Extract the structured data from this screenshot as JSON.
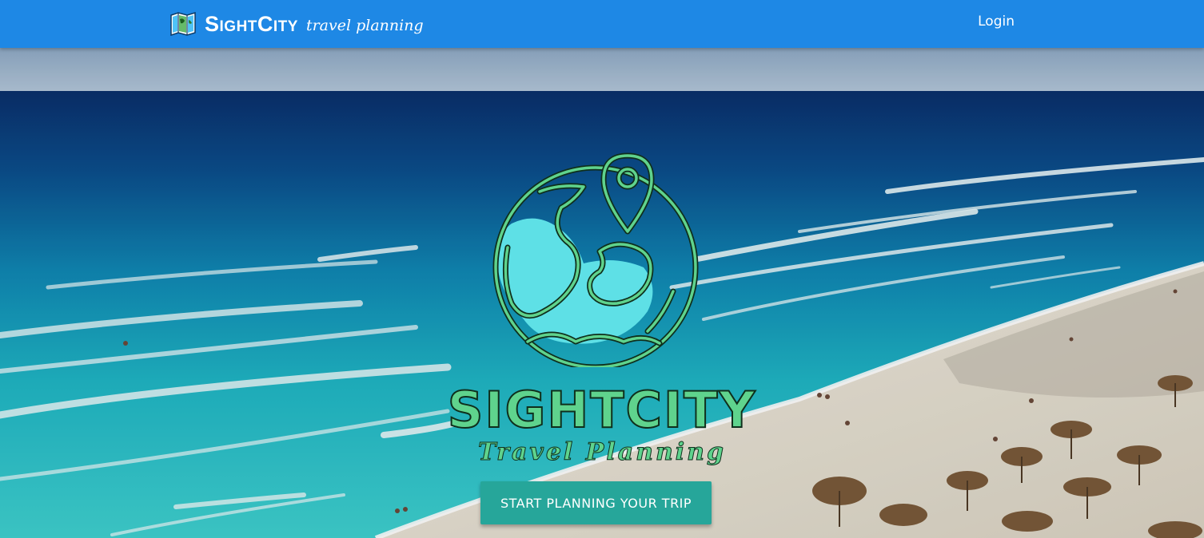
{
  "navbar": {
    "brand_name": "SightCity",
    "brand_tagline": "travel planning",
    "login_label": "Login",
    "background_color": "#1e88e5"
  },
  "hero": {
    "logo_wordmark": "SIGHTCITY",
    "logo_subtitle": "Travel Planning",
    "cta_label": "START PLANNING YOUR TRIP",
    "cta_color": "#26a69a",
    "logo_color": "#5fd38d",
    "background_image": "beach-aerial-photo",
    "logo_icon": "globe-location-pin-icon",
    "brand_icon": "folded-map-icon"
  }
}
